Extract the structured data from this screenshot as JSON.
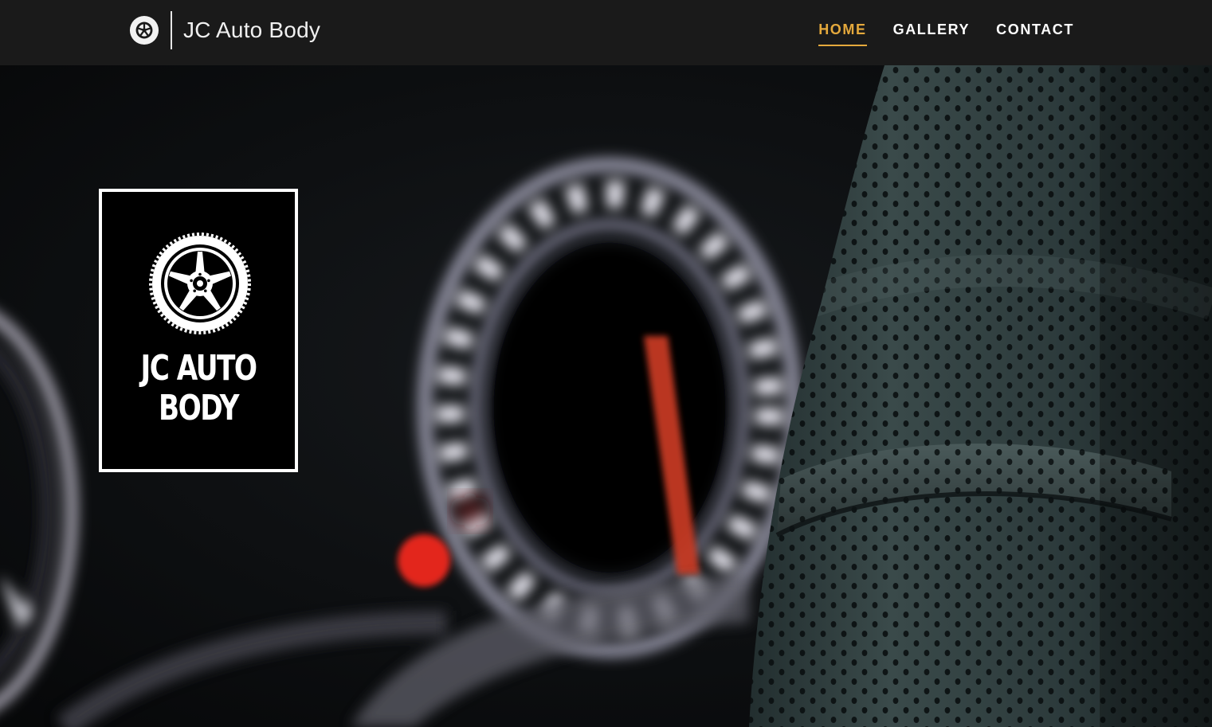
{
  "site": {
    "brand_name": "JC Auto Body",
    "brand_icon": "wheel-icon"
  },
  "nav": {
    "items": [
      {
        "label": "HOME",
        "active": true
      },
      {
        "label": "GALLERY",
        "active": false
      },
      {
        "label": "CONTACT",
        "active": false
      }
    ]
  },
  "hero": {
    "logo_line1": "JC AUTO",
    "logo_line2": "BODY",
    "logo_icon": "wheel-icon",
    "background": "car-dashboard-speedometer-steering-wheel-photo"
  },
  "colors": {
    "nav_bg": "#1a1a1a",
    "accent": "#e5a93c",
    "nav_text": "#ffffff"
  }
}
